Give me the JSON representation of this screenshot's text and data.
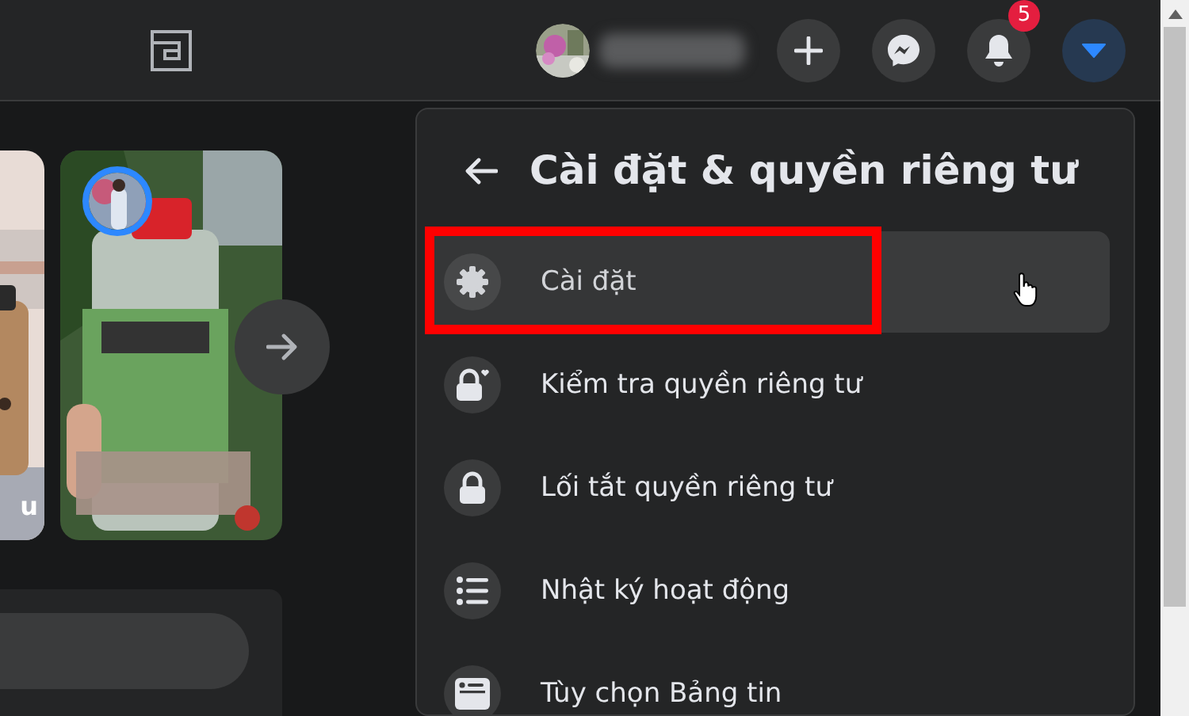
{
  "header": {
    "buttons": [
      {
        "kind": "plus",
        "selected": false
      },
      {
        "kind": "messenger",
        "selected": false
      },
      {
        "kind": "bell",
        "selected": false,
        "badge": "5"
      },
      {
        "kind": "caret",
        "selected": true
      }
    ]
  },
  "stories": [
    {
      "kind": "drink",
      "label": "u"
    },
    {
      "kind": "bottle"
    }
  ],
  "menu": {
    "title": "Cài đặt & quyền riêng tư",
    "items": [
      {
        "kind": "gear",
        "label": "Cài đặt",
        "selected": true,
        "highlighted": true
      },
      {
        "kind": "lock-heart",
        "label": "Kiểm tra quyền riêng tư",
        "selected": false,
        "highlighted": false
      },
      {
        "kind": "lock",
        "label": "Lối tắt quyền riêng tư",
        "selected": false,
        "highlighted": false
      },
      {
        "kind": "list",
        "label": "Nhật ký hoạt động",
        "selected": false,
        "highlighted": false
      },
      {
        "kind": "feed",
        "label": "Tùy chọn Bảng tin",
        "selected": false,
        "highlighted": false
      }
    ]
  }
}
